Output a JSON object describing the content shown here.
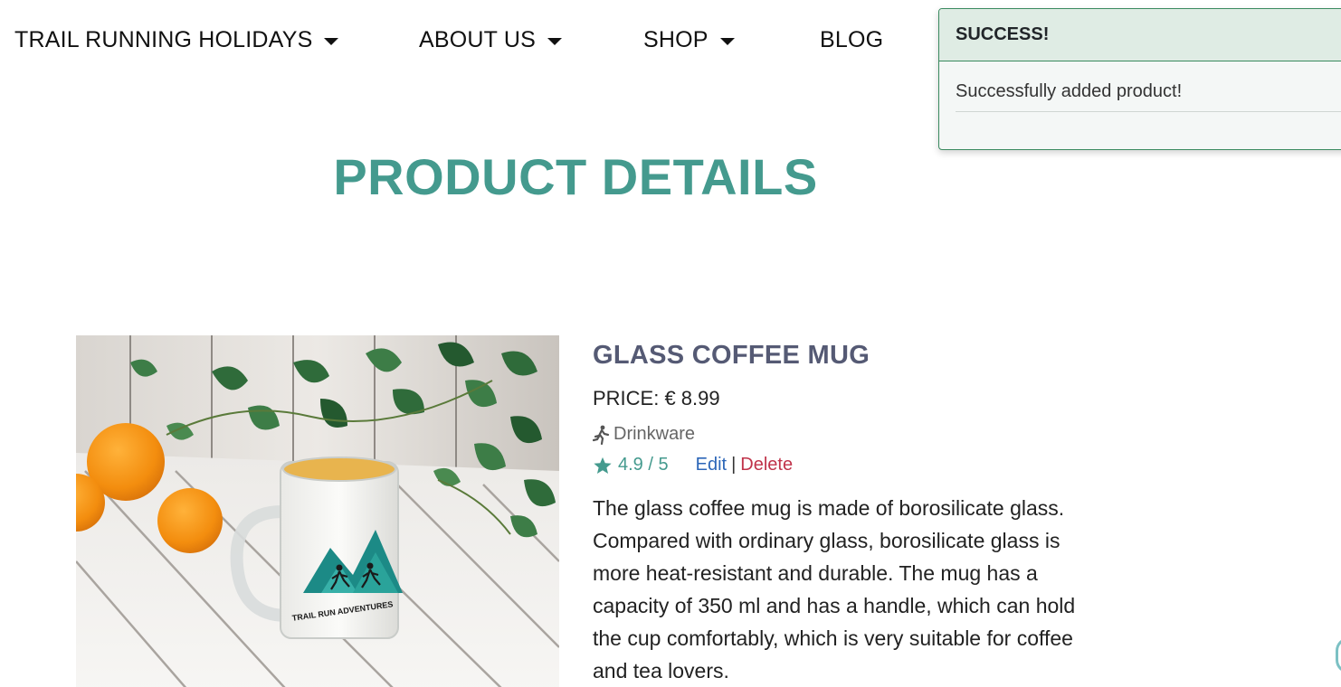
{
  "nav": {
    "items": [
      {
        "label": "TRAIL RUNNING HOLIDAYS",
        "has_dropdown": true
      },
      {
        "label": "ABOUT US",
        "has_dropdown": true
      },
      {
        "label": "SHOP",
        "has_dropdown": true
      },
      {
        "label": "BLOG",
        "has_dropdown": false
      }
    ]
  },
  "toast": {
    "title": "SUCCESS!",
    "message": "Successfully added product!",
    "accent_color": "#3a8a5f"
  },
  "page": {
    "title": "PRODUCT DETAILS",
    "title_color": "#449a8e"
  },
  "product": {
    "name": "GLASS COFFEE MUG",
    "price_label": "PRICE: € 8.99",
    "category_icon": "runner-icon",
    "category": "Drinkware",
    "rating_icon": "star-icon",
    "rating": "4.9 / 5",
    "edit_label": "Edit",
    "separator": "|",
    "delete_label": "Delete",
    "description": "The glass coffee mug is made of borosilicate glass. Compared with ordinary glass, borosilicate glass is more heat-resistant and durable. The mug has a capacity of 350 ml and has a handle, which can hold the cup comfortably, which is very suitable for coffee and tea lovers.",
    "image_logo_text": "TRAIL RUN ADVENTURES"
  }
}
